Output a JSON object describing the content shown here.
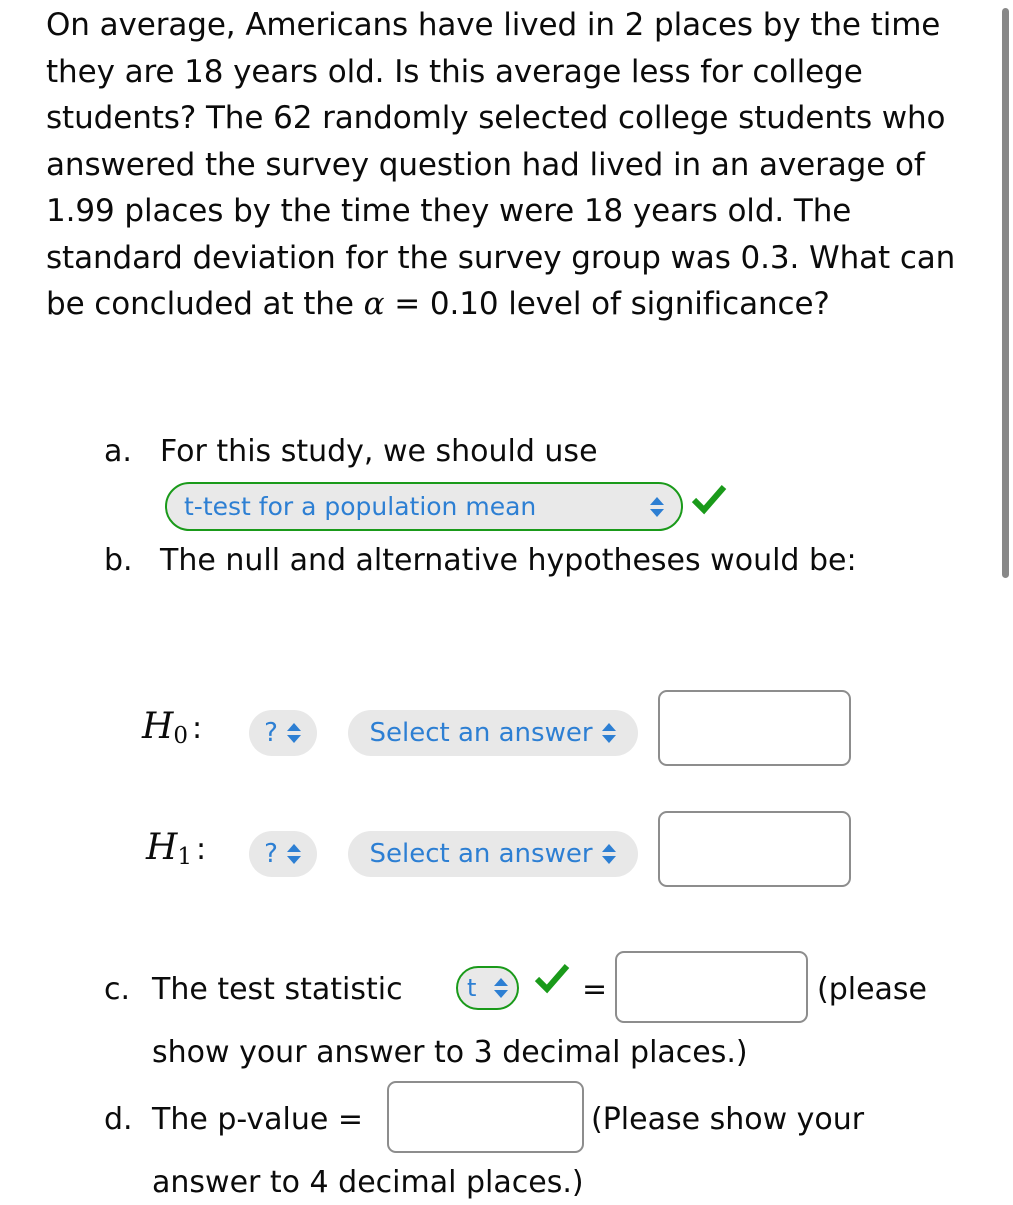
{
  "question": {
    "prompt_text": "On average, Americans have lived in 2 places by the time they are 18 years old. Is this average less for college students? The 62 randomly selected college students who answered the survey question had lived in an average of 1.99 places by the time they were 18 years old. The standard deviation for the survey group was 0.3. What can be concluded at the ",
    "alpha_symbol": "α",
    "alpha_statement": " = 0.10 level of significance?",
    "population_mean_places": "2",
    "age_threshold": "18",
    "sample_size": "62",
    "sample_mean": "1.99",
    "sample_sd": "0.3",
    "alpha_level": "0.10"
  },
  "parts": {
    "a": {
      "marker": "a.",
      "text": "For this study, we should use",
      "select_value": "t-test for a population mean",
      "validated": true
    },
    "b": {
      "marker": "b.",
      "text": "The null and alternative hypotheses would be:",
      "h0": {
        "label_h": "H",
        "label_sub": "0",
        "colon": ":",
        "operator_value": "?",
        "answer_value": "Select an answer",
        "input_value": ""
      },
      "h1": {
        "label_h": "H",
        "label_sub": "1",
        "colon": ":",
        "operator_value": "?",
        "answer_value": "Select an answer",
        "input_value": ""
      }
    },
    "c": {
      "marker": "c.",
      "text": "The test statistic",
      "select_value": "t",
      "validated": true,
      "equals": "=",
      "input_value": "",
      "tail_text": "(please",
      "line2_text": "show your answer to 3 decimal places.)"
    },
    "d": {
      "marker": "d.",
      "text": "The p-value =",
      "input_value": "",
      "tail_text": "(Please show your",
      "line2_text": "answer to 4 decimal places.)"
    }
  },
  "colors": {
    "accent_blue": "#2d7fd3",
    "validated_green": "#1a9a1a",
    "pill_gray": "#e8e8e8",
    "border_gray": "#8d8d8d",
    "text_black": "#0b0b0b",
    "scrollbar_gray": "#888888"
  },
  "icons": {
    "chevron": "chevron-up-down-icon",
    "check": "check-icon"
  }
}
